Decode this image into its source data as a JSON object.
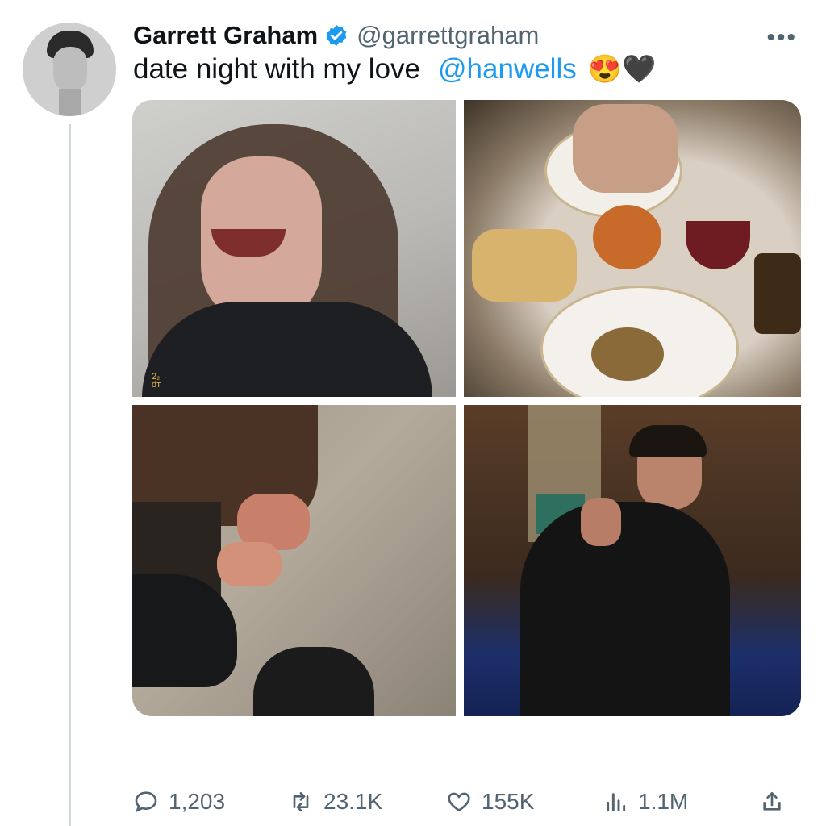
{
  "author": {
    "name": "Garrett Graham",
    "handle": "@garrettgraham"
  },
  "tweet": {
    "text": "date night with my love",
    "mention": "@hanwells",
    "emojis": "😍🖤",
    "image_caption_left": "2₂\ndт"
  },
  "metrics": {
    "replies": "1,203",
    "retweets": "23.1K",
    "likes": "155K",
    "views": "1.1M"
  },
  "icons": {
    "verified": "verified-badge-icon",
    "more": "more-options-icon",
    "reply": "reply-icon",
    "retweet": "retweet-icon",
    "like": "heart-icon",
    "views": "views-icon",
    "share": "share-icon"
  },
  "colors": {
    "accent": "#1d9bf0",
    "muted": "#536471",
    "text": "#0f1419"
  }
}
